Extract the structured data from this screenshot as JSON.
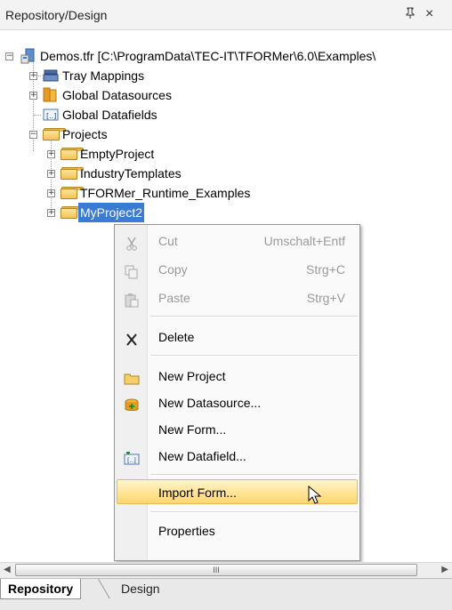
{
  "panel": {
    "title": "Repository/Design",
    "pin_glyph": "q",
    "close_glyph": "×"
  },
  "tree": {
    "root": "Demos.tfr [C:\\ProgramData\\TEC-IT\\TFORMer\\6.0\\Examples\\",
    "items": [
      {
        "label": "Tray Mappings",
        "icon": "tray-icon"
      },
      {
        "label": "Global Datasources",
        "icon": "database-icon"
      },
      {
        "label": "Global Datafields",
        "icon": "datafield-icon"
      },
      {
        "label": "Projects",
        "icon": "folder-icon"
      }
    ],
    "projects": [
      {
        "label": "EmptyProject"
      },
      {
        "label": "IndustryTemplates"
      },
      {
        "label": "TFORMer_Runtime_Examples"
      },
      {
        "label": "MyProject2"
      }
    ]
  },
  "context_menu": {
    "items": [
      {
        "label": "Cut",
        "shortcut": "Umschalt+Entf",
        "enabled": false,
        "icon": "scissors-icon"
      },
      {
        "label": "Copy",
        "shortcut": "Strg+C",
        "enabled": false,
        "icon": "copy-icon"
      },
      {
        "label": "Paste",
        "shortcut": "Strg+V",
        "enabled": false,
        "icon": "paste-icon"
      },
      {
        "label": "Delete",
        "shortcut": "",
        "enabled": true,
        "icon": "delete-icon"
      },
      {
        "label": "New Project",
        "shortcut": "",
        "enabled": true,
        "icon": "folder-icon"
      },
      {
        "label": "New Datasource...",
        "shortcut": "",
        "enabled": true,
        "icon": "new-datasource-icon"
      },
      {
        "label": "New Form...",
        "shortcut": "",
        "enabled": true,
        "icon": ""
      },
      {
        "label": "New Datafield...",
        "shortcut": "",
        "enabled": true,
        "icon": "new-datafield-icon"
      },
      {
        "label": "Import Form...",
        "shortcut": "",
        "enabled": true,
        "icon": "",
        "highlighted": true
      },
      {
        "label": "Properties",
        "shortcut": "",
        "enabled": true,
        "icon": ""
      }
    ]
  },
  "scrollbar": {
    "grip": "III"
  },
  "tabs": [
    {
      "label": "Repository",
      "active": true
    },
    {
      "label": "Design",
      "active": false
    }
  ],
  "colors": {
    "selection": "#3a7bd5",
    "menu_highlight": "#ffd66b",
    "folder": "#f0c45a"
  }
}
